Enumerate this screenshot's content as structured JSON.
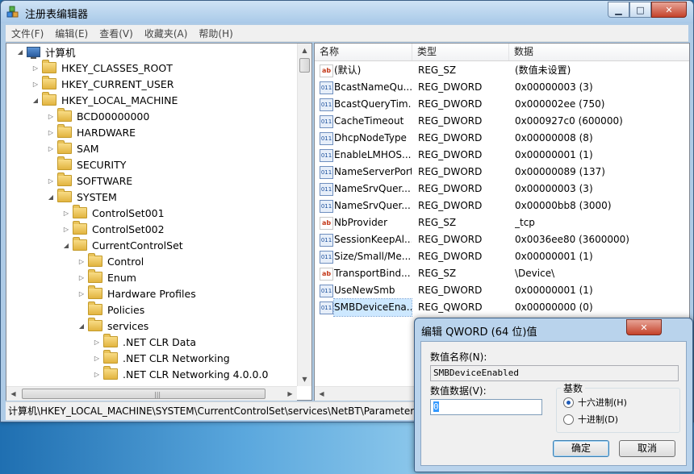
{
  "window": {
    "title": "注册表编辑器",
    "controls": {
      "minimize": "▁",
      "maximize": "□",
      "close": "✕"
    }
  },
  "menu": [
    "文件(F)",
    "编辑(E)",
    "查看(V)",
    "收藏夹(A)",
    "帮助(H)"
  ],
  "tree": [
    {
      "label": "计算机",
      "depth": 0,
      "expander": "open",
      "icon": "computer-icon"
    },
    {
      "label": "HKEY_CLASSES_ROOT",
      "depth": 1,
      "expander": "closed",
      "icon": "folder-icon"
    },
    {
      "label": "HKEY_CURRENT_USER",
      "depth": 1,
      "expander": "closed",
      "icon": "folder-icon"
    },
    {
      "label": "HKEY_LOCAL_MACHINE",
      "depth": 1,
      "expander": "open",
      "icon": "folder-icon"
    },
    {
      "label": "BCD00000000",
      "depth": 2,
      "expander": "closed",
      "icon": "folder-icon"
    },
    {
      "label": "HARDWARE",
      "depth": 2,
      "expander": "closed",
      "icon": "folder-icon"
    },
    {
      "label": "SAM",
      "depth": 2,
      "expander": "closed",
      "icon": "folder-icon"
    },
    {
      "label": "SECURITY",
      "depth": 2,
      "expander": "none",
      "icon": "folder-icon"
    },
    {
      "label": "SOFTWARE",
      "depth": 2,
      "expander": "closed",
      "icon": "folder-icon"
    },
    {
      "label": "SYSTEM",
      "depth": 2,
      "expander": "open",
      "icon": "folder-icon"
    },
    {
      "label": "ControlSet001",
      "depth": 3,
      "expander": "closed",
      "icon": "folder-icon"
    },
    {
      "label": "ControlSet002",
      "depth": 3,
      "expander": "closed",
      "icon": "folder-icon"
    },
    {
      "label": "CurrentControlSet",
      "depth": 3,
      "expander": "open",
      "icon": "folder-icon"
    },
    {
      "label": "Control",
      "depth": 4,
      "expander": "closed",
      "icon": "folder-icon"
    },
    {
      "label": "Enum",
      "depth": 4,
      "expander": "closed",
      "icon": "folder-icon"
    },
    {
      "label": "Hardware Profiles",
      "depth": 4,
      "expander": "closed",
      "icon": "folder-icon"
    },
    {
      "label": "Policies",
      "depth": 4,
      "expander": "none",
      "icon": "folder-icon"
    },
    {
      "label": "services",
      "depth": 4,
      "expander": "open",
      "icon": "folder-icon"
    },
    {
      "label": ".NET CLR Data",
      "depth": 5,
      "expander": "closed",
      "icon": "folder-icon"
    },
    {
      "label": ".NET CLR Networking",
      "depth": 5,
      "expander": "closed",
      "icon": "folder-icon"
    },
    {
      "label": ".NET CLR Networking 4.0.0.0",
      "depth": 5,
      "expander": "closed",
      "icon": "folder-icon"
    }
  ],
  "list": {
    "headers": {
      "name": "名称",
      "type": "类型",
      "data": "数据"
    },
    "rows": [
      {
        "icon": "string-value-icon",
        "icon_text": "ab",
        "name": "(默认)",
        "type": "REG_SZ",
        "data": "(数值未设置)"
      },
      {
        "icon": "binary-value-icon",
        "icon_text": "011",
        "name": "BcastNameQu...",
        "type": "REG_DWORD",
        "data": "0x00000003 (3)"
      },
      {
        "icon": "binary-value-icon",
        "icon_text": "011",
        "name": "BcastQueryTim...",
        "type": "REG_DWORD",
        "data": "0x000002ee (750)"
      },
      {
        "icon": "binary-value-icon",
        "icon_text": "011",
        "name": "CacheTimeout",
        "type": "REG_DWORD",
        "data": "0x000927c0 (600000)"
      },
      {
        "icon": "binary-value-icon",
        "icon_text": "011",
        "name": "DhcpNodeType",
        "type": "REG_DWORD",
        "data": "0x00000008 (8)"
      },
      {
        "icon": "binary-value-icon",
        "icon_text": "011",
        "name": "EnableLMHOS...",
        "type": "REG_DWORD",
        "data": "0x00000001 (1)"
      },
      {
        "icon": "binary-value-icon",
        "icon_text": "011",
        "name": "NameServerPort",
        "type": "REG_DWORD",
        "data": "0x00000089 (137)"
      },
      {
        "icon": "binary-value-icon",
        "icon_text": "011",
        "name": "NameSrvQuer...",
        "type": "REG_DWORD",
        "data": "0x00000003 (3)"
      },
      {
        "icon": "binary-value-icon",
        "icon_text": "011",
        "name": "NameSrvQuer...",
        "type": "REG_DWORD",
        "data": "0x00000bb8 (3000)"
      },
      {
        "icon": "string-value-icon",
        "icon_text": "ab",
        "name": "NbProvider",
        "type": "REG_SZ",
        "data": "_tcp"
      },
      {
        "icon": "binary-value-icon",
        "icon_text": "011",
        "name": "SessionKeepAl...",
        "type": "REG_DWORD",
        "data": "0x0036ee80 (3600000)"
      },
      {
        "icon": "binary-value-icon",
        "icon_text": "011",
        "name": "Size/Small/Me...",
        "type": "REG_DWORD",
        "data": "0x00000001 (1)"
      },
      {
        "icon": "string-value-icon",
        "icon_text": "ab",
        "name": "TransportBind...",
        "type": "REG_SZ",
        "data": "\\Device\\"
      },
      {
        "icon": "binary-value-icon",
        "icon_text": "011",
        "name": "UseNewSmb",
        "type": "REG_DWORD",
        "data": "0x00000001 (1)"
      },
      {
        "icon": "binary-value-icon",
        "icon_text": "011",
        "name": "SMBDeviceEna...",
        "type": "REG_QWORD",
        "data": "0x00000000 (0)",
        "selected": true
      }
    ]
  },
  "statusbar": "计算机\\HKEY_LOCAL_MACHINE\\SYSTEM\\CurrentControlSet\\services\\NetBT\\Parameters",
  "dialog": {
    "title": "编辑 QWORD (64 位)值",
    "close": "✕",
    "name_label": "数值名称(N):",
    "name_value": "SMBDeviceEnabled",
    "data_label": "数值数据(V):",
    "data_value": "0",
    "radix_title": "基数",
    "radix_hex": "十六进制(H)",
    "radix_dec": "十进制(D)",
    "radix_selected": "hex",
    "ok": "确定",
    "cancel": "取消"
  }
}
